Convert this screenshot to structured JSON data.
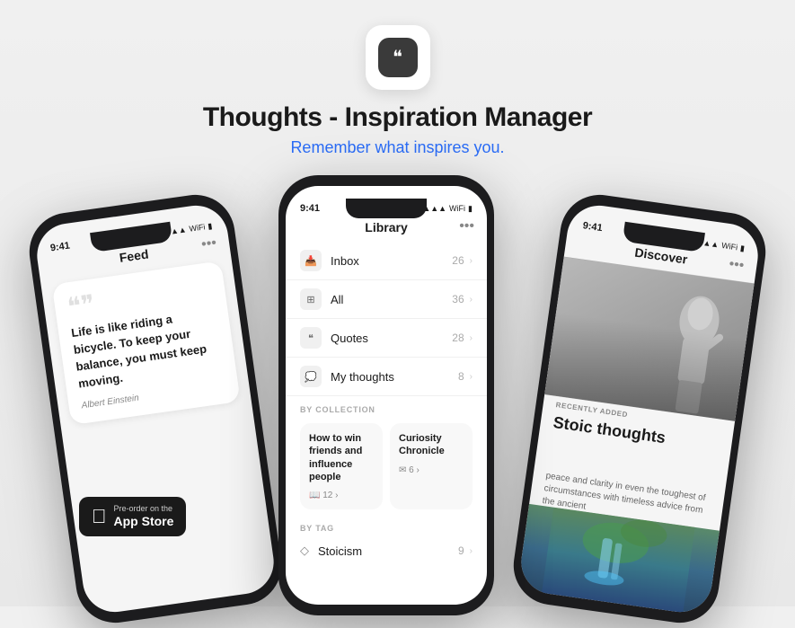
{
  "app": {
    "title": "Thoughts - Inspiration Manager",
    "subtitle": "Remember what inspires you.",
    "icon_alt": "Thoughts app icon"
  },
  "appstore": {
    "preorder_label": "Pre-order on the",
    "store_name": "App Store"
  },
  "phones": {
    "left": {
      "status_time": "9:41",
      "header": "Feed",
      "more_btn": "•••",
      "card": {
        "quote": "Life is like riding a bicycle. To keep your balance, you must keep moving.",
        "author": "Albert Einstein"
      }
    },
    "center": {
      "status_time": "9:41",
      "header": "Library",
      "more_btn": "•••",
      "rows": [
        {
          "icon": "📥",
          "label": "Inbox",
          "count": "26"
        },
        {
          "icon": "⊞",
          "label": "All",
          "count": "36"
        },
        {
          "icon": "❝",
          "label": "Quotes",
          "count": "28"
        },
        {
          "icon": "💭",
          "label": "My thoughts",
          "count": "8"
        }
      ],
      "by_collection_label": "BY COLLECTION",
      "collections": [
        {
          "name": "How to win friends and influence people",
          "count": "12"
        },
        {
          "name": "Curiosity Chronicle",
          "count": "6"
        }
      ],
      "by_tag_label": "BY TAG",
      "tags": [
        {
          "label": "Stoicism",
          "count": "9"
        }
      ]
    },
    "right": {
      "status_time": "9:41",
      "header": "Discover",
      "more_btn": "•••",
      "recently_added": "RECENTLY ADDED",
      "quote_title": "Stoic thoughts",
      "quote_desc": "peace and clarity in even the toughest of circumstances with timeless advice from the ancient"
    }
  }
}
